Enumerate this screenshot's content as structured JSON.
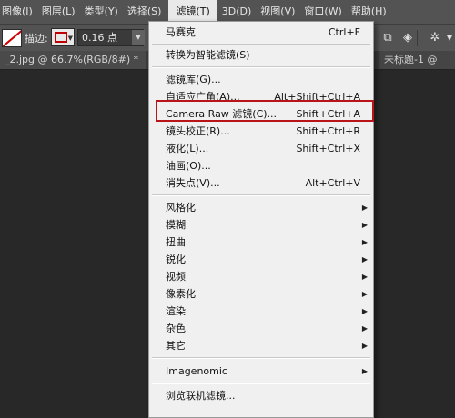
{
  "menubar": {
    "items": [
      "图像(I)",
      "图层(L)",
      "类型(Y)",
      "选择(S)",
      "滤镜(T)",
      "3D(D)",
      "视图(V)",
      "窗口(W)",
      "帮助(H)"
    ]
  },
  "options": {
    "stroke_label": "描边:",
    "size_value": "0.16 点"
  },
  "tabs": {
    "doc_title": "_2.jpg @ 66.7%(RGB/8#) *",
    "close_glyph": "×",
    "other_doc": "未标题-1 @"
  },
  "menu": {
    "top": {
      "label": "马赛克",
      "shortcut": "Ctrl+F"
    },
    "smart": {
      "label": "转换为智能滤镜(S)"
    },
    "group2": [
      {
        "label": "滤镜库(G)...",
        "shortcut": ""
      },
      {
        "label": "自适应广角(A)...",
        "shortcut": "Alt+Shift+Ctrl+A"
      },
      {
        "label": "Camera Raw 滤镜(C)...",
        "shortcut": "Shift+Ctrl+A"
      },
      {
        "label": "镜头校正(R)...",
        "shortcut": "Shift+Ctrl+R"
      },
      {
        "label": "液化(L)...",
        "shortcut": "Shift+Ctrl+X"
      },
      {
        "label": "油画(O)...",
        "shortcut": ""
      },
      {
        "label": "消失点(V)...",
        "shortcut": "Alt+Ctrl+V"
      }
    ],
    "group3": [
      "风格化",
      "模糊",
      "扭曲",
      "锐化",
      "视频",
      "像素化",
      "渲染",
      "杂色",
      "其它"
    ],
    "imagenomic": "Imagenomic",
    "browse": "浏览联机滤镜...",
    "submenu_arrow": "▶"
  },
  "icons": {
    "dropdown": "▼",
    "stack": "⧉",
    "layers": "◈",
    "gear": "✲",
    "chevron": "▾"
  },
  "colors": {
    "highlight_box": "#b8141a",
    "stroke_color": "#c00000"
  }
}
